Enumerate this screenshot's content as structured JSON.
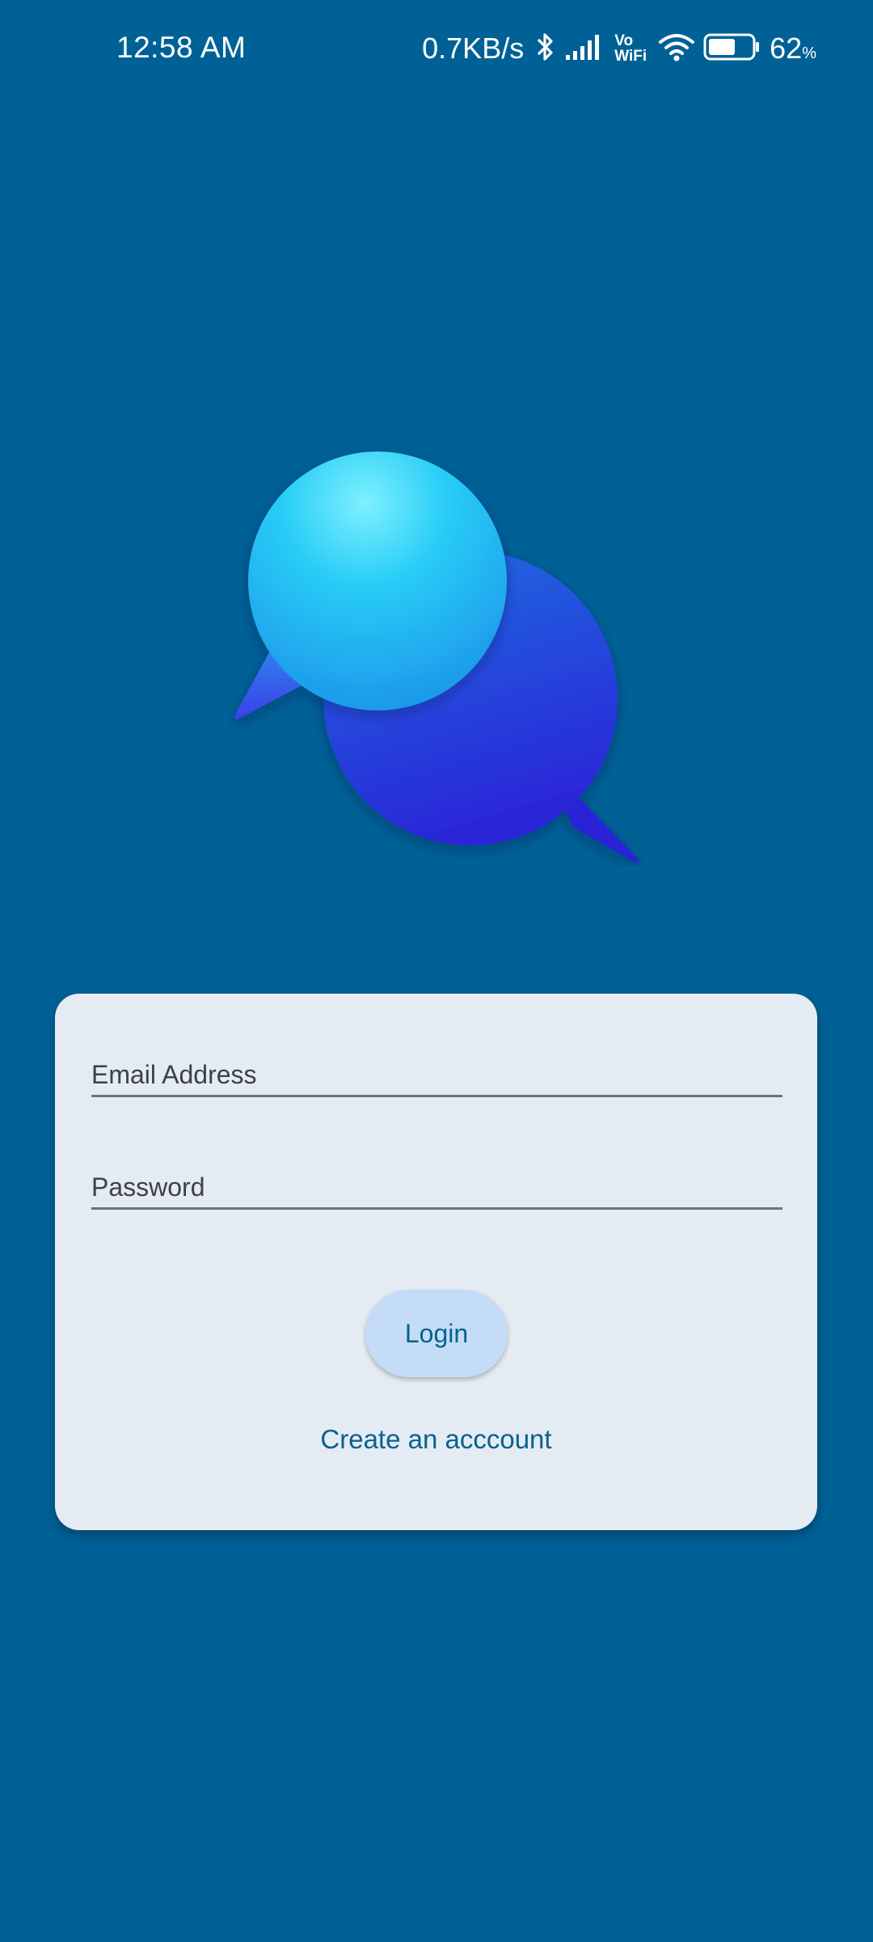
{
  "status_bar": {
    "time": "12:58 AM",
    "net_speed": "0.7KB/s",
    "vowifi_top": "Vo",
    "vowifi_bottom": "WiFi",
    "battery_percent": "62",
    "battery_unit": "%",
    "battery_level": 0.62
  },
  "logo": {
    "icon": "chat-bubbles-icon"
  },
  "login_form": {
    "email_label": "Email Address",
    "password_label": "Password",
    "login_label": "Login",
    "create_account_label": "Create an acccount"
  },
  "colors": {
    "background": "#006196",
    "card": "#e5ebf3",
    "button": "#c4dcf5",
    "accent_text": "#06628f"
  }
}
